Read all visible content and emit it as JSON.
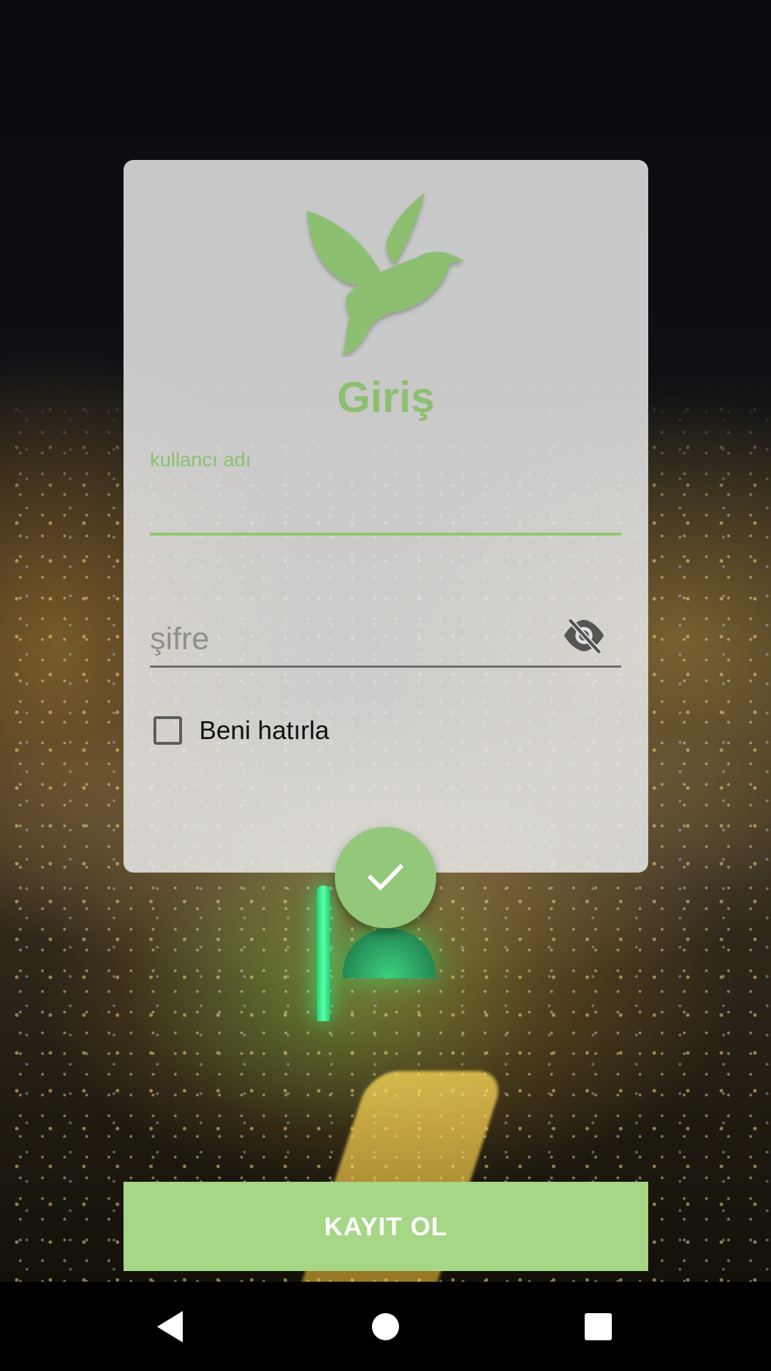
{
  "login": {
    "title": "Giriş",
    "username_label": "kullancı adı",
    "username_value": "",
    "password_placeholder": "şifre",
    "remember_label": "Beni hatırla",
    "remember_checked": false
  },
  "register_button": {
    "label": "KAYIT OL"
  },
  "icons": {
    "logo": "dove-icon",
    "password_toggle": "eye-off-icon",
    "submit": "check-icon",
    "nav_back": "back-triangle-icon",
    "nav_home": "home-circle-icon",
    "nav_recents": "recents-square-icon"
  },
  "colors": {
    "accent": "#8dbf70",
    "register_button": "#a6d786",
    "fab": "#93c77a"
  }
}
